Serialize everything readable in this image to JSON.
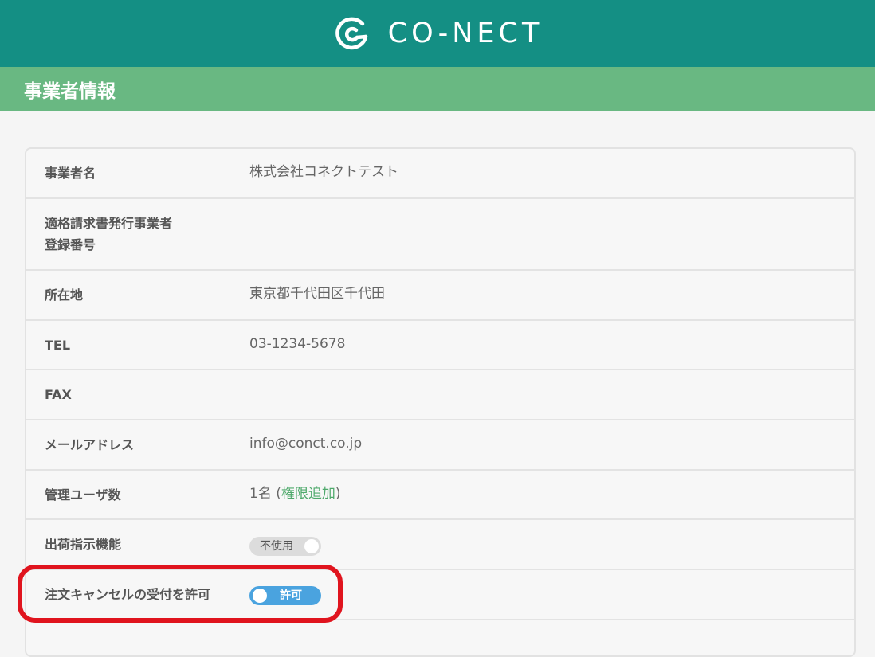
{
  "header": {
    "brand": "CO-NECT",
    "logo_icon": "conect-logo-icon",
    "brand_color": "#148f84"
  },
  "section": {
    "title": "事業者情報",
    "color": "#69b882"
  },
  "rows": [
    {
      "label": "事業者名",
      "value": "株式会社コネクトテスト"
    },
    {
      "label_line1": "適格請求書発行事業者",
      "label_line2": "登録番号",
      "value": ""
    },
    {
      "label": "所在地",
      "value": "東京都千代田区千代田"
    },
    {
      "label": "TEL",
      "value": "03-1234-5678"
    },
    {
      "label": "FAX",
      "value": ""
    },
    {
      "label": "メールアドレス",
      "value": "info@conct.co.jp"
    },
    {
      "label": "管理ユーザ数",
      "value_count": "1名",
      "paren_open": "(",
      "link": "権限追加",
      "paren_close": ")"
    },
    {
      "label": "出荷指示機能",
      "toggle_label": "不使用",
      "toggle_state": "off"
    },
    {
      "label": "注文キャンセルの受付を許可",
      "toggle_label": "許可",
      "toggle_state": "on"
    }
  ],
  "colors": {
    "toggle_on": "#4aa3df",
    "toggle_off": "#dcdcdc",
    "link": "#4ea96b",
    "highlight": "#e0141e"
  }
}
